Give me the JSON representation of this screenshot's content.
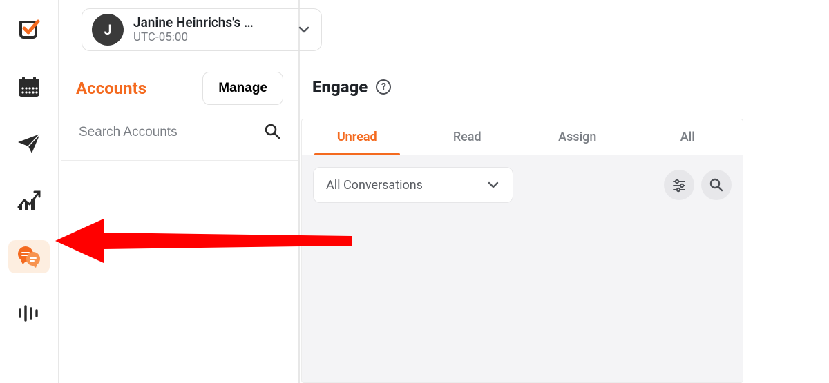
{
  "header": {
    "avatar_initial": "J",
    "account_name": "Janine Heinrichs's …",
    "timezone": "UTC-05:00"
  },
  "accounts": {
    "title": "Accounts",
    "manage_label": "Manage",
    "search_placeholder": "Search Accounts"
  },
  "engage": {
    "title": "Engage",
    "tabs": {
      "unread": "Unread",
      "read": "Read",
      "assign": "Assign",
      "all": "All"
    },
    "filter_selected": "All Conversations"
  },
  "rail": {
    "items": [
      "logo",
      "calendar",
      "send",
      "analytics",
      "engage",
      "audio"
    ]
  }
}
